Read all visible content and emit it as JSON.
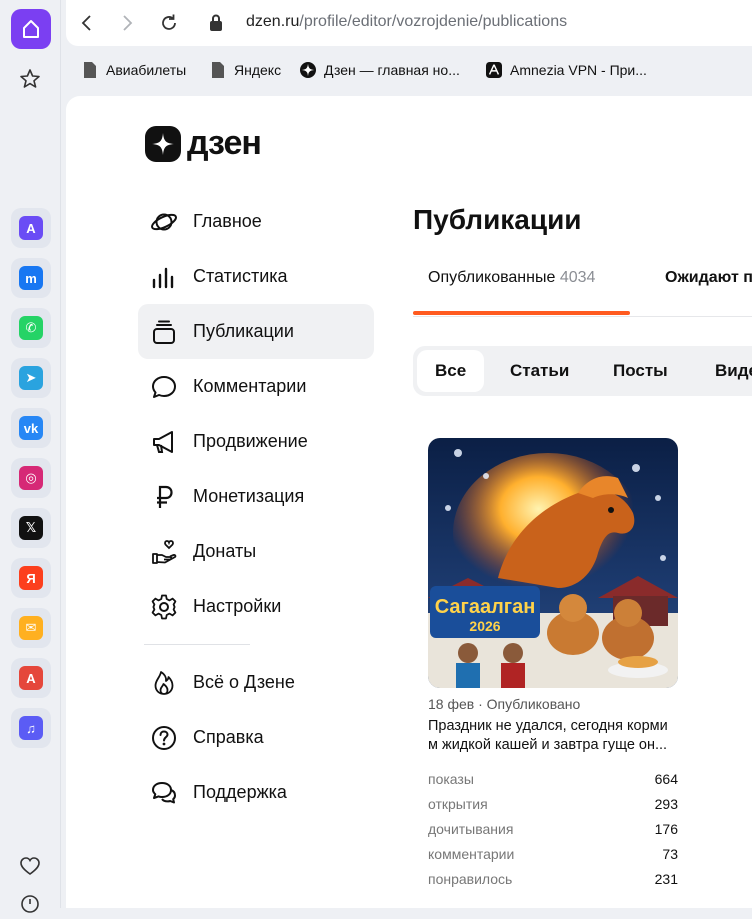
{
  "browser": {
    "url_host": "dzen.ru",
    "url_path": "/profile/editor/vozrojdenie/publications",
    "bookmarks": [
      {
        "label": "Авиабилеты",
        "icon": "document-icon"
      },
      {
        "label": "Яндекс",
        "icon": "document-icon"
      },
      {
        "label": "Дзен — главная но...",
        "icon": "dzen-icon"
      },
      {
        "label": "Amnezia VPN - При...",
        "icon": "amnezia-icon"
      }
    ],
    "sidebar_apps": [
      {
        "name": "aliasing-app-icon",
        "color": "#6a4cf5",
        "glyph": "A"
      },
      {
        "name": "messenger-icon",
        "color": "#1877f2",
        "glyph": "m"
      },
      {
        "name": "whatsapp-icon",
        "color": "#25d366",
        "glyph": "✆"
      },
      {
        "name": "telegram-icon",
        "color": "#2aa3df",
        "glyph": "➤"
      },
      {
        "name": "vk-icon",
        "color": "#2787f5",
        "glyph": "vk"
      },
      {
        "name": "instagram-icon",
        "color": "#d62976",
        "glyph": "◎"
      },
      {
        "name": "x-icon",
        "color": "#111111",
        "glyph": "𝕏"
      },
      {
        "name": "yandex-icon",
        "color": "#fc3f1d",
        "glyph": "Я"
      },
      {
        "name": "mail-icon",
        "color": "#ffb020",
        "glyph": "✉"
      },
      {
        "name": "translate-icon",
        "color": "#e5473b",
        "glyph": "A"
      },
      {
        "name": "music-icon",
        "color": "#5b5cf5",
        "glyph": "♫"
      }
    ]
  },
  "logo": {
    "text": "дзен"
  },
  "menu": {
    "main": [
      {
        "label": "Главное",
        "icon": "planet-icon"
      },
      {
        "label": "Статистика",
        "icon": "bar-chart-icon"
      },
      {
        "label": "Публикации",
        "icon": "publications-icon",
        "active": true
      },
      {
        "label": "Комментарии",
        "icon": "comment-icon"
      },
      {
        "label": "Продвижение",
        "icon": "megaphone-icon"
      },
      {
        "label": "Монетизация",
        "icon": "ruble-icon"
      },
      {
        "label": "Донаты",
        "icon": "donate-hand-icon"
      },
      {
        "label": "Настройки",
        "icon": "gear-icon"
      }
    ],
    "secondary": [
      {
        "label": "Всё о Дзене",
        "icon": "flame-icon"
      },
      {
        "label": "Справка",
        "icon": "help-icon"
      },
      {
        "label": "Поддержка",
        "icon": "support-chat-icon"
      }
    ]
  },
  "page": {
    "title": "Публикации",
    "tabs": [
      {
        "label": "Опубликованные",
        "count": "4034"
      },
      {
        "label": "Ожидают п",
        "count": ""
      }
    ],
    "filters": [
      "Все",
      "Статьи",
      "Посты",
      "Виде"
    ]
  },
  "card": {
    "meta": "18 фев · Опубликовано",
    "title": "Праздник не удался, сегодня корми м жидкой кашей и завтра гуще он...",
    "cover_text": [
      "Сагаалган",
      "2026"
    ],
    "stats": [
      {
        "label": "показы",
        "value": "664"
      },
      {
        "label": "открытия",
        "value": "293"
      },
      {
        "label": "дочитывания",
        "value": "176"
      },
      {
        "label": "комментарии",
        "value": "73"
      },
      {
        "label": "понравилось",
        "value": "231"
      }
    ]
  },
  "colors": {
    "accent": "#ff5a1f",
    "browser_brand": "#7b3ff2"
  }
}
